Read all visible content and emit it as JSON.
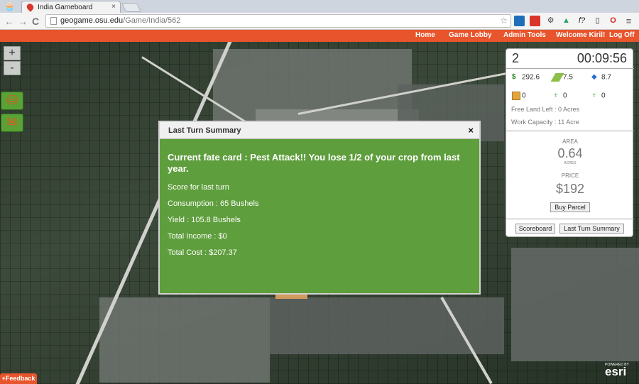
{
  "browser": {
    "tab_title": "India Gameboard",
    "tab_close": "×",
    "url_host": "geogame.osu.edu",
    "url_path": "/Game/India/562",
    "back_glyph": "←",
    "forward_glyph": "→",
    "reload_glyph": "C",
    "menu_glyph": "≡"
  },
  "nav": {
    "home": "Home",
    "lobby": "Game Lobby",
    "admin": "Admin Tools",
    "welcome": "Welcome Kiril!",
    "logoff": "Log Off"
  },
  "map_controls": {
    "zoom_in": "+",
    "zoom_out": "-",
    "basket_icon": "basket-icon",
    "mail_icon": "mail-icon"
  },
  "panel": {
    "turn": "2",
    "timer": "00:09:56",
    "money": "292.6",
    "land": "7.5",
    "water": "8.7",
    "seed": "0",
    "crop_a": "0",
    "crop_b": "0",
    "free_land": "Free Land Left : 0 Acres",
    "work_capacity": "Work Capacity : 11 Acre",
    "area_label": "AREA",
    "area_value": "0.64",
    "area_unit": "ACRES",
    "price_label": "PRICE",
    "price_value": "$192",
    "buy_parcel": "Buy Parcel",
    "scoreboard": "Scoreboard",
    "last_turn_summary": "Last Turn Summary"
  },
  "modal": {
    "title": "Last Turn Summary",
    "close": "×",
    "fate": "Current fate card : Pest Attack!! You lose 1/2 of your crop from last year.",
    "score_title": "Score for last turn",
    "consumption": "Consumption : 65 Bushels",
    "yield": "Yield : 105.8 Bushels",
    "income": "Total Income : $0",
    "cost": "Total Cost : $207.37"
  },
  "footer": {
    "feedback": "+Feedback",
    "powered": "POWERED BY",
    "esri": "esri"
  },
  "colors": {
    "accent": "#e8542c",
    "modal_green": "#5e9e3c"
  }
}
